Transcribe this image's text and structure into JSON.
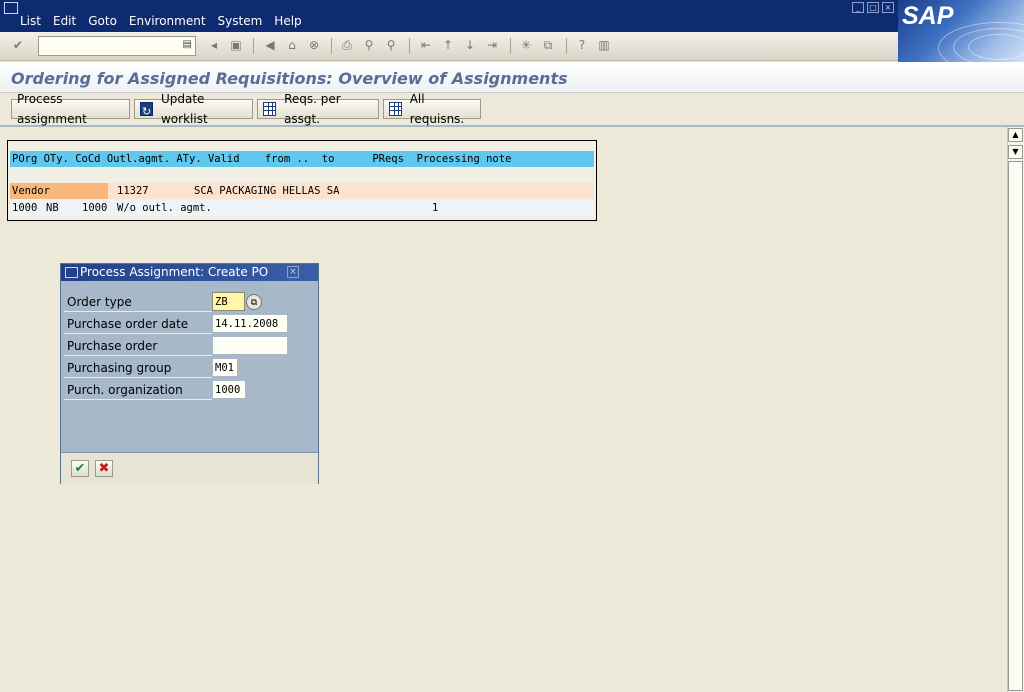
{
  "menubar": {
    "items": [
      "List",
      "Edit",
      "Goto",
      "Environment",
      "System",
      "Help"
    ],
    "logo": "SAP"
  },
  "toolbar": {
    "command_field": "",
    "icons": [
      "enter-icon",
      "back-icon",
      "save-icon",
      "exit-icon",
      "cancel-icon",
      "print-icon",
      "find-icon",
      "find-next-icon",
      "first-page-icon",
      "previous-page-icon",
      "next-page-icon",
      "last-page-icon",
      "create-session-icon",
      "shortcut-icon",
      "help-icon",
      "layout-icon"
    ]
  },
  "title": "Ordering for Assigned Requisitions: Overview of Assignments",
  "app_toolbar": {
    "process_assignment": "Process assignment",
    "update_worklist": "Update worklist",
    "reqs_per_assgt": "Reqs. per assgt.",
    "all_requisns": "All requisns."
  },
  "list": {
    "header": "POrg OTy. CoCd Outl.agmt. ATy. Valid    from ..  to      PReqs  Processing note",
    "vendor_label": "Vendor",
    "vendor_number": "11327",
    "vendor_name": "SCA PACKAGING HELLAS SA",
    "row": {
      "porg": "1000",
      "oty": "NB",
      "cocd": "1000",
      "outline_agreement": "W/o outl. agmt.",
      "preqs": "1"
    }
  },
  "dialog": {
    "title": "Process Assignment: Create PO",
    "fields": [
      {
        "label": "Order type",
        "value": "ZB"
      },
      {
        "label": "Purchase order date",
        "value": "14.11.2008"
      },
      {
        "label": "Purchase order",
        "value": ""
      },
      {
        "label": "Purchasing group",
        "value": "M01"
      },
      {
        "label": "Purch. organization",
        "value": "1000"
      }
    ],
    "buttons": [
      "continue-icon",
      "cancel-icon"
    ]
  },
  "colors": {
    "menubar_bg": "#0e2a70",
    "list_header_bg": "#5fc8ee",
    "vendor_row_bg": "#fde3ce",
    "vendor_label_bg": "#f9b77c",
    "dialog_bg": "#a7b9c8",
    "required_field_bg": "#fff6a8"
  }
}
